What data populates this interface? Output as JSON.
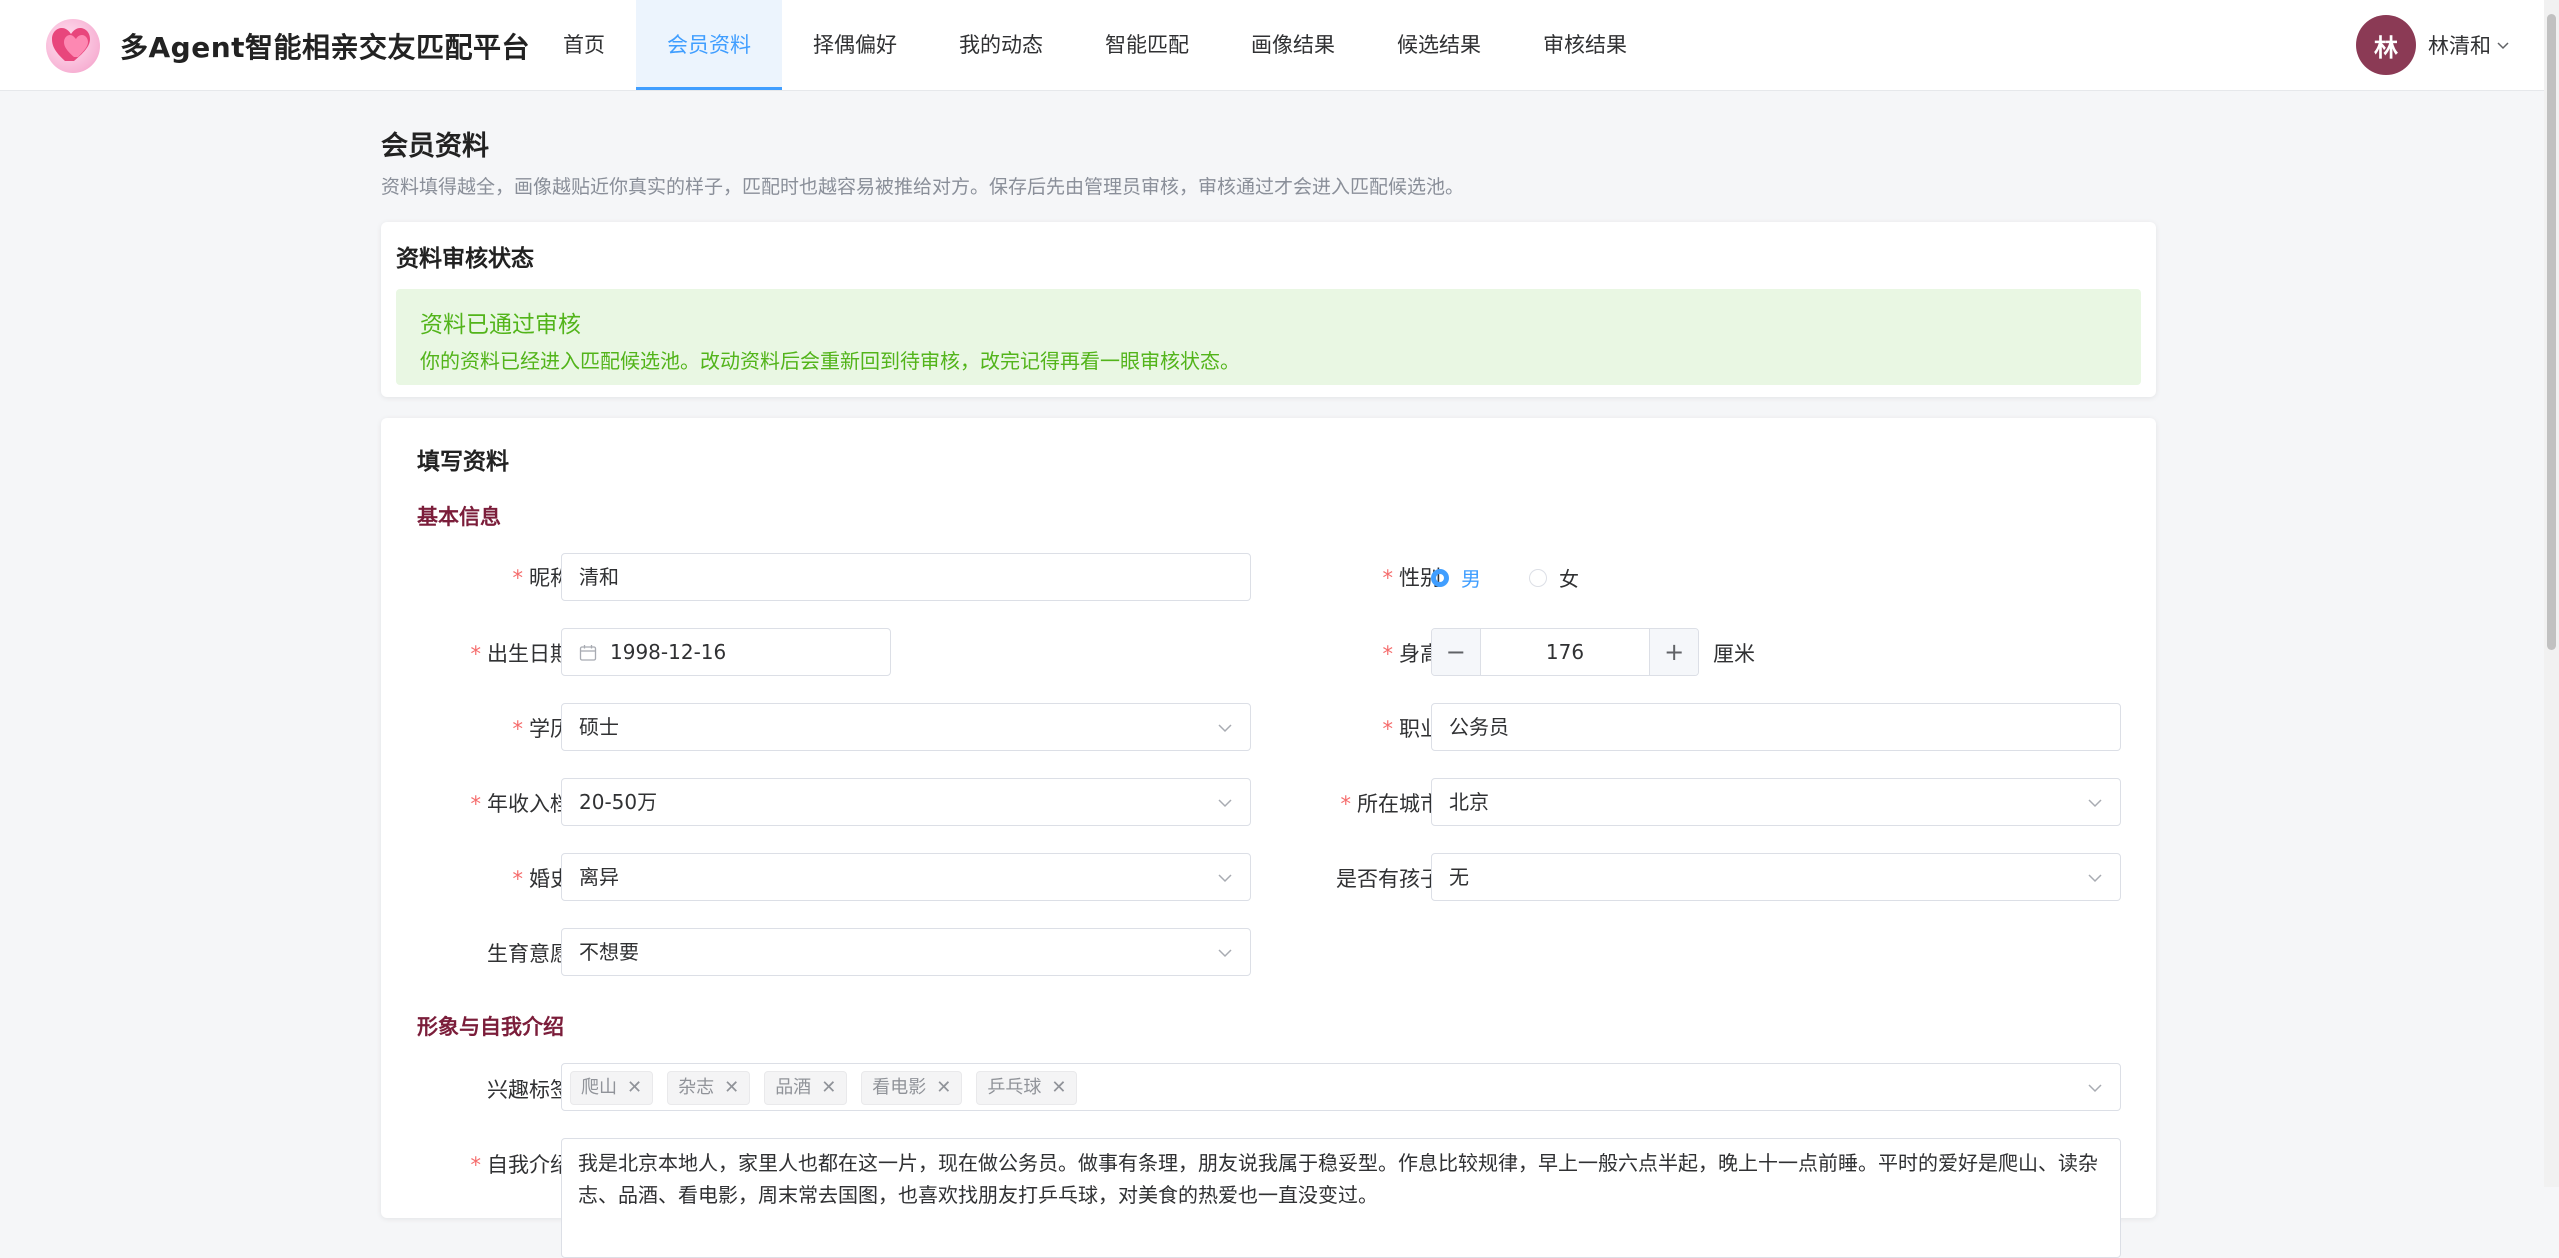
{
  "app": {
    "title": "多Agent智能相亲交友匹配平台"
  },
  "nav": {
    "items": [
      {
        "label": "首页"
      },
      {
        "label": "会员资料"
      },
      {
        "label": "择偶偏好"
      },
      {
        "label": "我的动态"
      },
      {
        "label": "智能匹配"
      },
      {
        "label": "画像结果"
      },
      {
        "label": "候选结果"
      },
      {
        "label": "审核结果"
      }
    ],
    "active_index": 1
  },
  "user": {
    "avatar_text": "林",
    "name": "林清和",
    "avatar_color": "#8b3a55"
  },
  "page": {
    "title": "会员资料",
    "subtitle": "资料填得越全，画像越贴近你真实的样子，匹配时也越容易被推给对方。保存后先由管理员审核，审核通过才会进入匹配候选池。"
  },
  "review": {
    "card_title": "资料审核状态",
    "alert_title": "资料已通过审核",
    "alert_desc": "你的资料已经进入匹配候选池。改动资料后会重新回到待审核，改完记得再看一眼审核状态。",
    "status_color": "#52b41a"
  },
  "form": {
    "card_title": "填写资料",
    "basic_section": "基本信息",
    "nickname": {
      "label": "昵称",
      "value": "清和"
    },
    "gender": {
      "label": "性别",
      "options": [
        "男",
        "女"
      ],
      "selected": "男"
    },
    "birthday": {
      "label": "出生日期",
      "value": "1998-12-16",
      "icon": "calendar-icon"
    },
    "height": {
      "label": "身高",
      "value": "176",
      "unit": "厘米",
      "minus": "−",
      "plus": "+"
    },
    "education": {
      "label": "学历",
      "value": "硕士"
    },
    "job": {
      "label": "职业",
      "value": "公务员"
    },
    "income": {
      "label": "年收入档",
      "value": "20-50万"
    },
    "city": {
      "label": "所在城市",
      "value": "北京"
    },
    "marriage": {
      "label": "婚史",
      "value": "离异"
    },
    "children": {
      "label": "是否有孩子",
      "value": "无"
    },
    "fertility": {
      "label": "生育意愿",
      "value": "不想要"
    },
    "image_section": "形象与自我介绍",
    "interests": {
      "label": "兴趣标签",
      "tags": [
        "爬山",
        "杂志",
        "品酒",
        "看电影",
        "乒乓球"
      ]
    },
    "intro": {
      "label": "自我介绍",
      "value": "我是北京本地人，家里人也都在这一片，现在做公务员。做事有条理，朋友说我属于稳妥型。作息比较规律，早上一般六点半起，晚上十一点前睡。平时的爱好是爬山、读杂志、品酒、看电影，周末常去国图，也喜欢找朋友打乒乓球，对美食的热爱也一直没变过。"
    }
  },
  "colors": {
    "accent": "#409eff",
    "section": "#7b1d3a",
    "required": "#f56c6c"
  }
}
